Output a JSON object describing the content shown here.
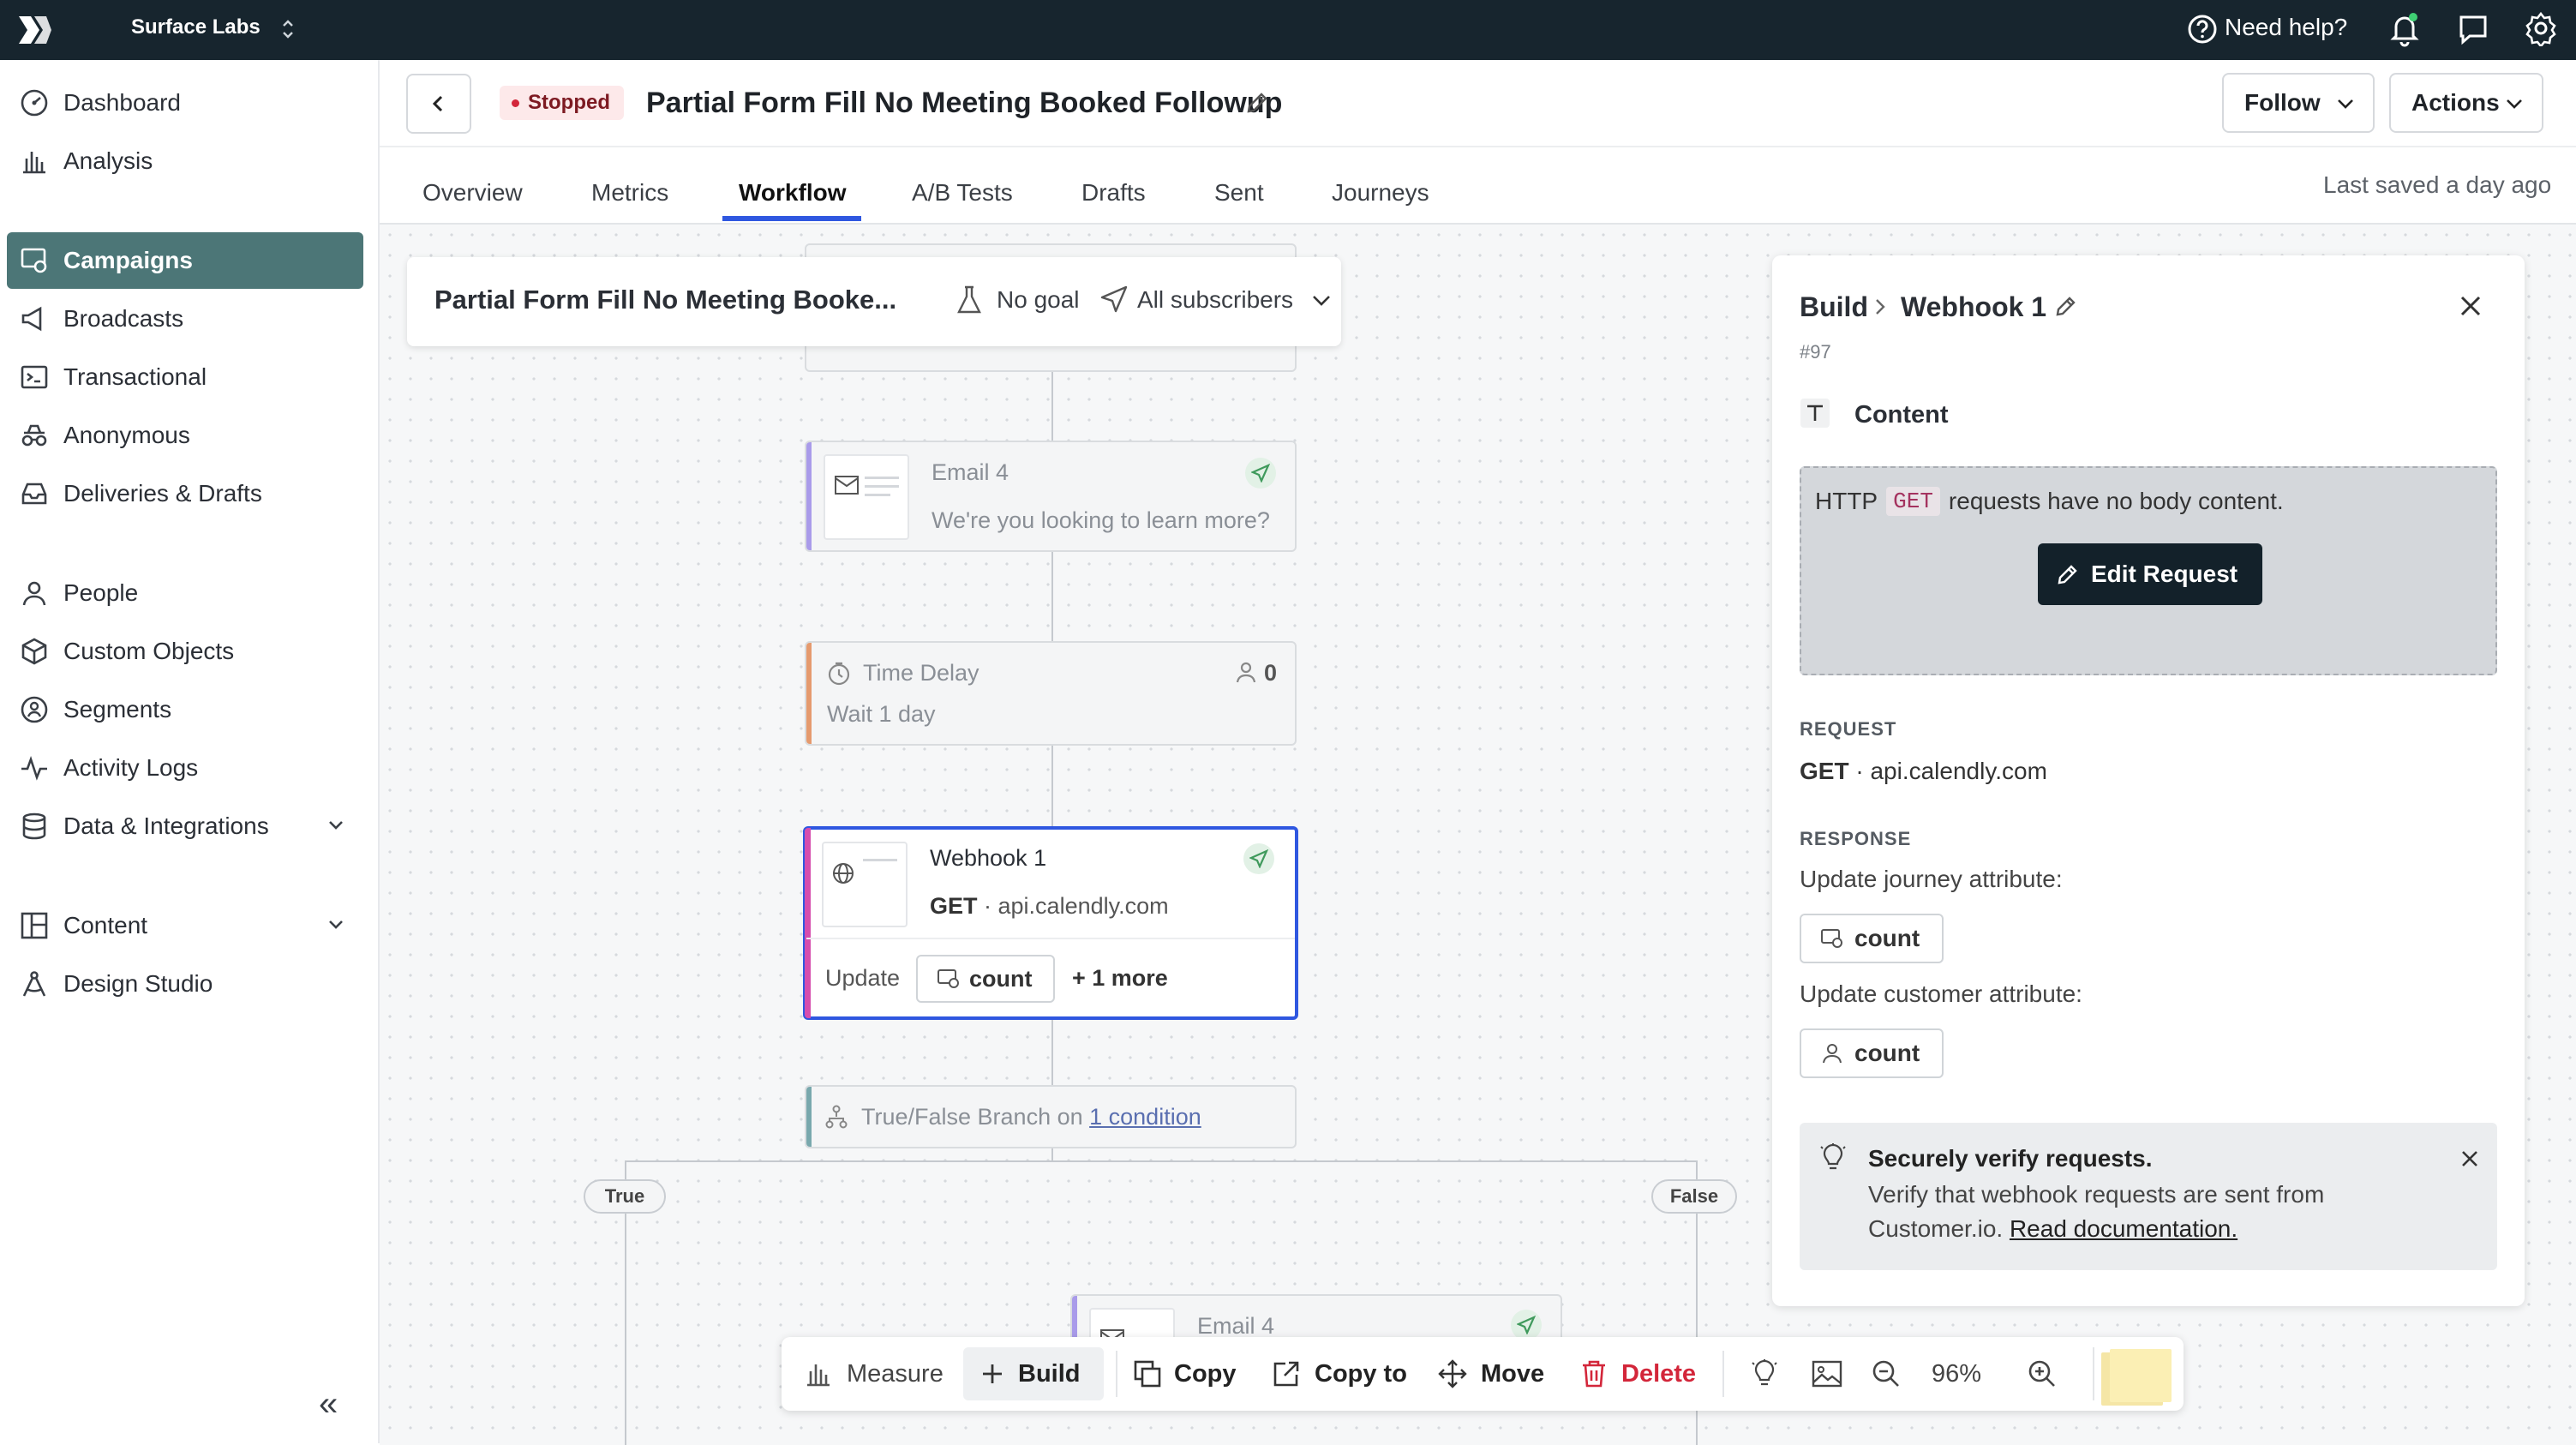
{
  "topbar": {
    "org": "Surface Labs",
    "help": "Need help?"
  },
  "sidebar": {
    "items": [
      {
        "label": "Dashboard"
      },
      {
        "label": "Analysis"
      },
      {
        "label": "Campaigns"
      },
      {
        "label": "Broadcasts"
      },
      {
        "label": "Transactional"
      },
      {
        "label": "Anonymous"
      },
      {
        "label": "Deliveries & Drafts"
      },
      {
        "label": "People"
      },
      {
        "label": "Custom Objects"
      },
      {
        "label": "Segments"
      },
      {
        "label": "Activity Logs"
      },
      {
        "label": "Data & Integrations"
      },
      {
        "label": "Content"
      },
      {
        "label": "Design Studio"
      }
    ],
    "collapse": "«"
  },
  "header": {
    "status": "Stopped",
    "title": "Partial Form Fill No Meeting Booked Followup",
    "follow": "Follow",
    "actions": "Actions",
    "tabs": [
      "Overview",
      "Metrics",
      "Workflow",
      "A/B Tests",
      "Drafts",
      "Sent",
      "Journeys"
    ],
    "last_saved": "Last saved a day ago"
  },
  "canvas": {
    "summary": {
      "name": "Partial Form Fill No Meeting Booke...",
      "goal": "No goal",
      "audience": "All subscribers"
    },
    "email4": {
      "title": "Email 4",
      "subtitle": "We're you looking to learn more?"
    },
    "delay": {
      "title": "Time Delay",
      "subtitle": "Wait 1 day",
      "count": "0"
    },
    "webhook": {
      "title": "Webhook 1",
      "method": "GET",
      "url": "· api.calendly.com",
      "update": "Update",
      "attr": "count",
      "more": "+ 1 more"
    },
    "branch": {
      "prefix": "True/False Branch on ",
      "link": "1 condition",
      "true": "True",
      "false": "False"
    },
    "email4b": {
      "title": "Email 4"
    }
  },
  "panel": {
    "crumb": "Build",
    "title": "Webhook 1",
    "id": "#97",
    "content_label": "Content",
    "http_pre": "HTTP",
    "http_code": "GET",
    "http_post": "requests have no body content.",
    "edit_request": "Edit Request",
    "request_label": "REQUEST",
    "request_method": "GET",
    "request_url": "· api.calendly.com",
    "response_label": "RESPONSE",
    "journey_attr_label": "Update journey attribute:",
    "journey_attr": "count",
    "customer_attr_label": "Update customer attribute:",
    "customer_attr": "count",
    "notice_title": "Securely verify requests.",
    "notice_body": "Verify that webhook requests are sent from",
    "notice_body2": "Customer.io.",
    "notice_link": "Read documentation."
  },
  "toolbar": {
    "measure": "Measure",
    "build": "Build",
    "copy": "Copy",
    "copy_to": "Copy to",
    "move": "Move",
    "delete": "Delete",
    "zoom": "96%"
  },
  "colors": {
    "accent": "#4c7677",
    "topbar": "#17252e",
    "selected": "#2f57e0",
    "danger": "#d3263a",
    "webhook_bar": "#d64dae",
    "email_bar": "#a99bea",
    "delay_bar": "#e59a6e",
    "branch_bar": "#79a8ad"
  }
}
